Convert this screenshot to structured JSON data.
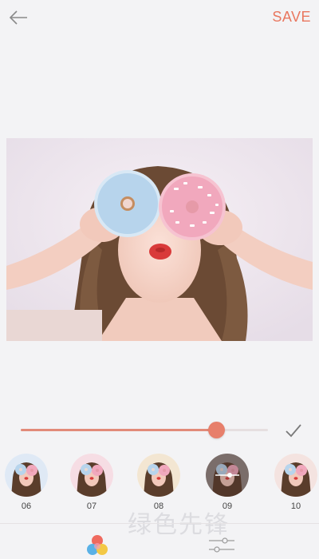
{
  "topbar": {
    "back_icon": "arrow-left-icon",
    "save_label": "SAVE"
  },
  "editor": {
    "photo_description_icon": "photo",
    "intensity": 0.79
  },
  "filters": [
    {
      "label": "06",
      "selected": false
    },
    {
      "label": "07",
      "selected": false
    },
    {
      "label": "08",
      "selected": false
    },
    {
      "label": "09",
      "selected": true
    },
    {
      "label": "10",
      "selected": false
    }
  ],
  "bottombar": {
    "color_filter_icon": "color-filter-icon",
    "adjust_icon": "adjust-icon"
  },
  "watermark": {
    "text": "绿色先锋"
  },
  "colors": {
    "accent": "#e9775f",
    "slider_fill": "#e28a79",
    "background": "#f3f3f5"
  }
}
